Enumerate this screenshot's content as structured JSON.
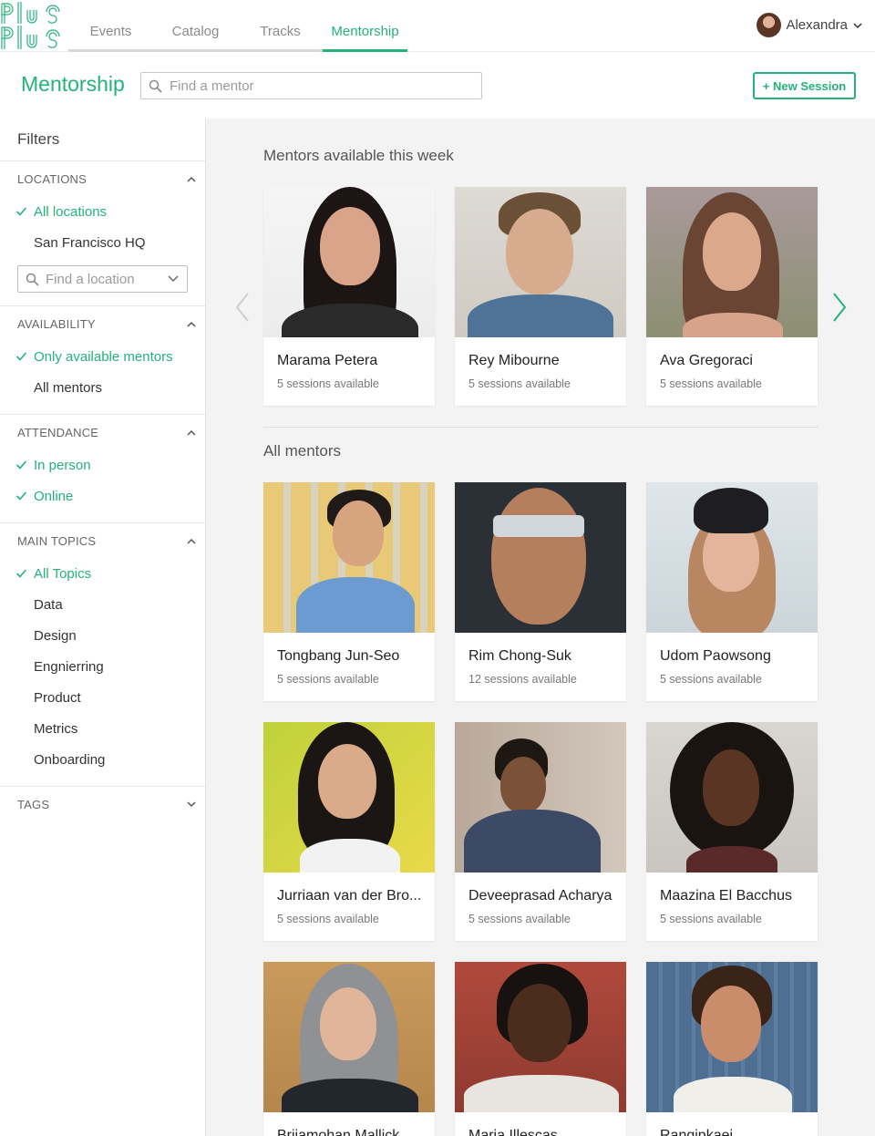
{
  "nav": {
    "logo_text": "Plus Plus",
    "tabs": [
      {
        "label": "Events",
        "active": false
      },
      {
        "label": "Catalog",
        "active": false
      },
      {
        "label": "Tracks",
        "active": false
      },
      {
        "label": "Mentorship",
        "active": true
      }
    ],
    "user_name": "Alexandra"
  },
  "header": {
    "title": "Mentorship",
    "search_placeholder": "Find a mentor",
    "new_session_label": "+ New Session"
  },
  "sidebar": {
    "title": "Filters",
    "locations": {
      "heading": "LOCATIONS",
      "items": [
        {
          "label": "All locations",
          "checked": true
        },
        {
          "label": "San Francisco HQ",
          "checked": false
        }
      ],
      "find_placeholder": "Find a location"
    },
    "availability": {
      "heading": "AVAILABILITY",
      "items": [
        {
          "label": "Only available mentors",
          "checked": true
        },
        {
          "label": "All mentors",
          "checked": false
        }
      ]
    },
    "attendance": {
      "heading": "ATTENDANCE",
      "items": [
        {
          "label": "In person",
          "checked": true
        },
        {
          "label": "Online",
          "checked": true
        }
      ]
    },
    "topics": {
      "heading": "MAIN TOPICS",
      "items": [
        {
          "label": "All Topics",
          "checked": true
        },
        {
          "label": "Data",
          "checked": false
        },
        {
          "label": "Design",
          "checked": false
        },
        {
          "label": "Engnierring",
          "checked": false
        },
        {
          "label": "Product",
          "checked": false
        },
        {
          "label": "Metrics",
          "checked": false
        },
        {
          "label": "Onboarding",
          "checked": false
        }
      ]
    },
    "tags": {
      "heading": "TAGS"
    }
  },
  "week": {
    "title": "Mentors available this week",
    "mentors": [
      {
        "name": "Marama Petera",
        "sessions": "5 sessions available"
      },
      {
        "name": "Rey Mibourne",
        "sessions": "5 sessions available"
      },
      {
        "name": "Ava Gregoraci",
        "sessions": "5 sessions available"
      }
    ]
  },
  "all": {
    "title": "All mentors",
    "mentors": [
      {
        "name": "Tongbang Jun-Seo",
        "sessions": "5 sessions available"
      },
      {
        "name": "Rim Chong-Suk",
        "sessions": "12 sessions available"
      },
      {
        "name": "Udom Paowsong",
        "sessions": "5 sessions available"
      },
      {
        "name": "Jurriaan van der Bro...",
        "sessions": "5 sessions available"
      },
      {
        "name": "Deveeprasad Acharya",
        "sessions": "5 sessions available"
      },
      {
        "name": "Maazina El Bacchus",
        "sessions": "5 sessions available"
      },
      {
        "name": "Brijamohan Mallick",
        "sessions": ""
      },
      {
        "name": "Maria Illescas",
        "sessions": ""
      },
      {
        "name": "Rangipkaei",
        "sessions": ""
      }
    ]
  },
  "colors": {
    "accent": "#24b27b",
    "main_bg": "#f3f3f3"
  }
}
